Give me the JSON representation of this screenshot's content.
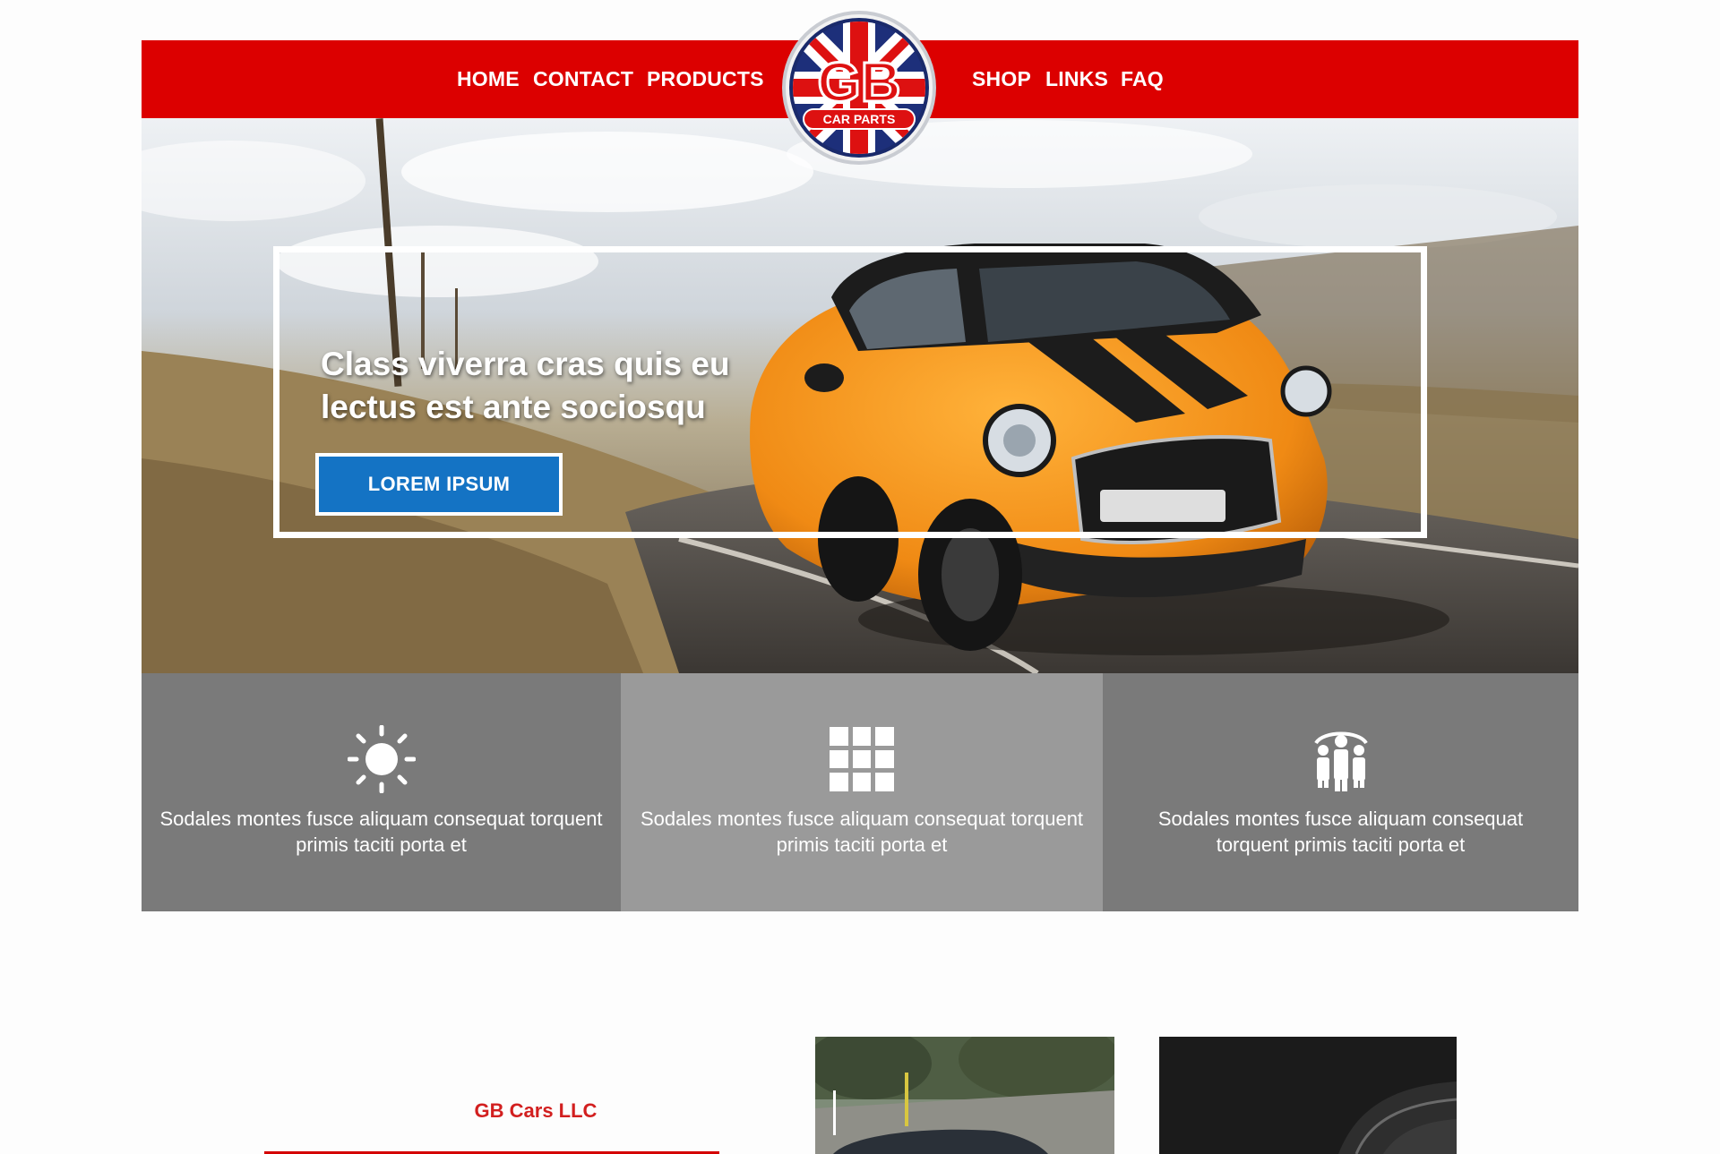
{
  "nav": {
    "left_items": [
      {
        "label": "HOME"
      },
      {
        "label": "CONTACT"
      },
      {
        "label": "PRODUCTS"
      }
    ],
    "right_items": [
      {
        "label": "SHOP"
      },
      {
        "label": "LINKS"
      },
      {
        "label": "FAQ"
      }
    ]
  },
  "logo": {
    "text": "GB",
    "subtext": "CAR PARTS"
  },
  "hero": {
    "heading": "Class viverra cras quis eu lectus est ante sociosqu",
    "cta_label": "LOREM IPSUM",
    "image": "orange-hatchback-on-road"
  },
  "features": [
    {
      "icon": "sun-icon",
      "text": "Sodales montes fusce aliquam consequat torquent primis taciti porta et",
      "color": "#7a7a7a"
    },
    {
      "icon": "grid-icon",
      "text": "Sodales montes fusce aliquam consequat torquent primis taciti porta et",
      "color": "#9a9a9a"
    },
    {
      "icon": "team-icon",
      "text": "Sodales montes fusce aliquam consequat torquent primis taciti porta et",
      "color": "#7a7a7a"
    }
  ],
  "lower": {
    "company_name": "GB Cars LLC",
    "thumbnails": [
      "convertible-on-road",
      "dark-car-closeup"
    ]
  },
  "colors": {
    "nav_red": "#dc0000",
    "cta_blue": "#1473c4",
    "company_red": "#d21f1f"
  }
}
